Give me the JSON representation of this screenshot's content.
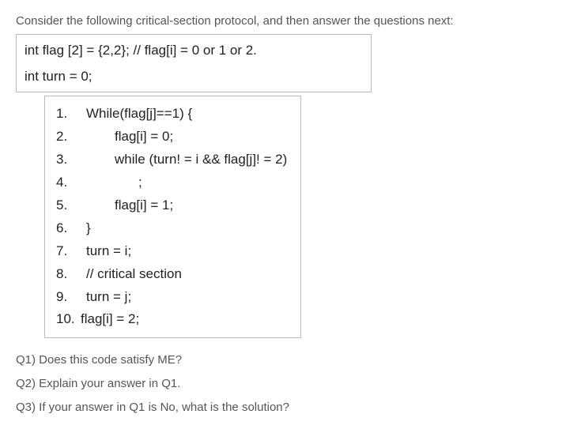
{
  "intro": "Consider the following critical-section protocol, and then answer the questions next:",
  "decl1": "int flag [2] = {2,2};   // flag[i] = 0 or 1 or 2.",
  "decl2": "int turn = 0;",
  "lines": {
    "l1": "While(flag[j]==1) {",
    "l2": "flag[i] = 0;",
    "l3": "while (turn! = i && flag[j]! = 2)",
    "l4": ";",
    "l5": "flag[i] = 1;",
    "l6": "}",
    "l7": "turn = i;",
    "l8": "// critical section",
    "l9": "turn = j;",
    "l10": "flag[i] = 2;"
  },
  "nums": {
    "n1": "1.",
    "n2": "2.",
    "n3": "3.",
    "n4": "4.",
    "n5": "5.",
    "n6": "6.",
    "n7": "7.",
    "n8": "8.",
    "n9": "9.",
    "n10": "10."
  },
  "q1": "Q1) Does this code satisfy ME?",
  "q2": "Q2) Explain your answer in Q1.",
  "q3": "Q3) If your answer in Q1 is No, what is the solution?"
}
